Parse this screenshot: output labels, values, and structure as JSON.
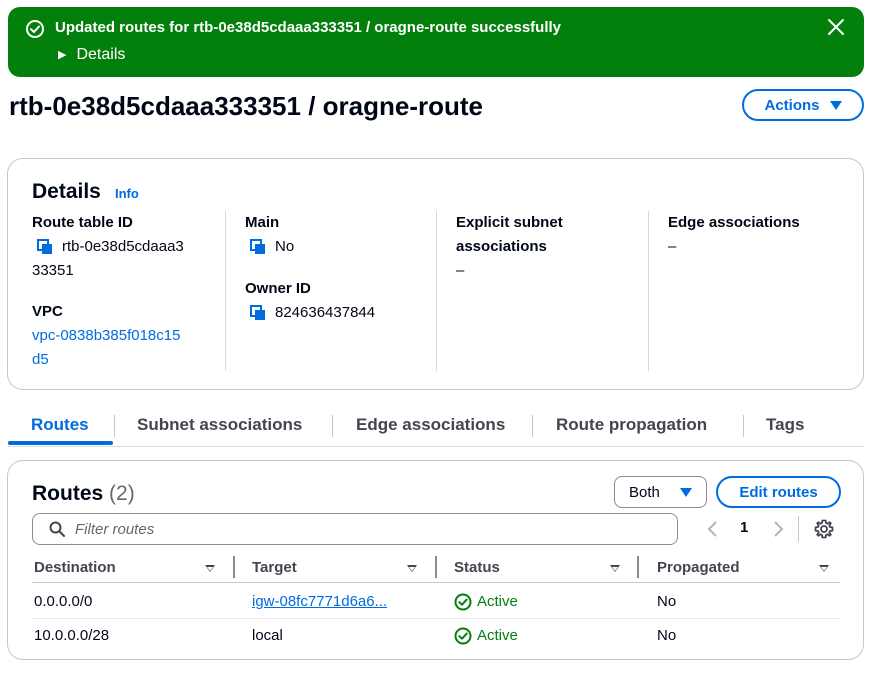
{
  "flash": {
    "message": "Updated routes for rtb-0e38d5cdaaa333351 / oragne-route successfully",
    "details_label": "Details"
  },
  "page": {
    "title": "rtb-0e38d5cdaaa333351 / oragne-route",
    "actions_label": "Actions"
  },
  "details": {
    "heading": "Details",
    "info_label": "Info",
    "route_table_id_label": "Route table ID",
    "route_table_id_line1": "rtb-0e38d5cdaaa3",
    "route_table_id_line2": "33351",
    "vpc_label": "VPC",
    "vpc_line1": "vpc-0838b385f018c15",
    "vpc_line2": "d5",
    "main_label": "Main",
    "main_value": "No",
    "owner_id_label": "Owner ID",
    "owner_id_value": "824636437844",
    "explicit_label_line1": "Explicit subnet",
    "explicit_label_line2": "associations",
    "explicit_value": "–",
    "edge_label": "Edge associations",
    "edge_value": "–"
  },
  "tabs": [
    {
      "label": "Routes",
      "active": true
    },
    {
      "label": "Subnet associations",
      "active": false
    },
    {
      "label": "Edge associations",
      "active": false
    },
    {
      "label": "Route propagation",
      "active": false
    },
    {
      "label": "Tags",
      "active": false
    }
  ],
  "routes": {
    "heading": "Routes",
    "count": "(2)",
    "filter_select": "Both",
    "edit_label": "Edit routes",
    "filter_placeholder": "Filter routes",
    "page_number": "1",
    "columns": [
      "Destination",
      "Target",
      "Status",
      "Propagated"
    ],
    "rows": [
      {
        "destination": "0.0.0.0/0",
        "target": "igw-08fc7771d6a6...",
        "status": "Active",
        "propagated": "No"
      },
      {
        "destination": "10.0.0.0/28",
        "target": "local",
        "status": "Active",
        "propagated": "No"
      }
    ]
  },
  "colors": {
    "success": "#037f0c",
    "link": "#006ce0",
    "text": "#000716",
    "border": "#c6c6cd"
  }
}
